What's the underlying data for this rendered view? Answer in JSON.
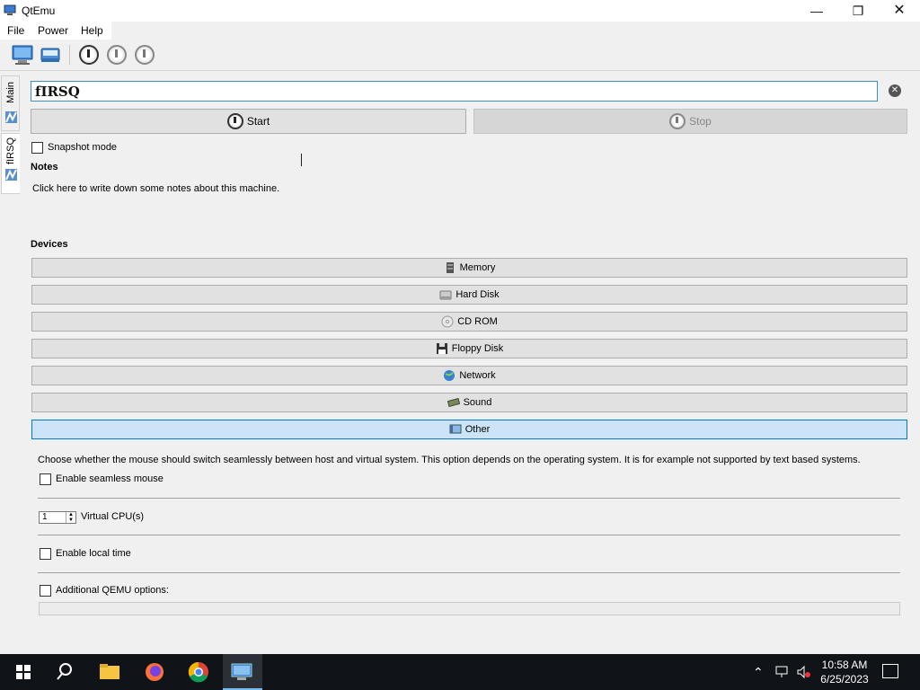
{
  "window": {
    "title": "QtEmu",
    "controls": {
      "minimize": "—",
      "maximize": "❐",
      "close": "✕"
    }
  },
  "menu": {
    "file": "File",
    "power": "Power",
    "help": "Help"
  },
  "toolbar": {
    "icons": [
      "new-machine-icon",
      "open-machine-icon",
      "start-icon",
      "stop-icon",
      "restart-icon"
    ]
  },
  "side_tabs": {
    "main": "Main",
    "machine": "fIRSQ"
  },
  "machine": {
    "name": "fIRSQ",
    "start_label": "Start",
    "stop_label": "Stop",
    "snapshot_label": "Snapshot mode",
    "snapshot_checked": false,
    "notes_heading": "Notes",
    "notes_placeholder": "Click here to write down some notes about this machine."
  },
  "devices": {
    "heading": "Devices",
    "items": [
      {
        "label": "Memory",
        "icon": "memory-icon"
      },
      {
        "label": "Hard Disk",
        "icon": "hard-disk-icon"
      },
      {
        "label": "CD ROM",
        "icon": "cdrom-icon"
      },
      {
        "label": "Floppy Disk",
        "icon": "floppy-icon"
      },
      {
        "label": "Network",
        "icon": "network-icon"
      },
      {
        "label": "Sound",
        "icon": "sound-icon"
      },
      {
        "label": "Other",
        "icon": "other-icon",
        "selected": true
      }
    ]
  },
  "other": {
    "description": "Choose whether the mouse should switch seamlessly between host and virtual system. This option depends on the operating system. It is for example not supported by text based systems.",
    "seamless_label": "Enable seamless mouse",
    "cpu_value": "1",
    "cpu_label": "Virtual CPU(s)",
    "localtime_label": "Enable local time",
    "qemu_options_label": "Additional QEMU options:",
    "qemu_options_value": ""
  },
  "taskbar": {
    "time": "10:58 AM",
    "date": "6/25/2023"
  },
  "colors": {
    "accent": "#0078d7",
    "selected_bg": "#cce4f7",
    "taskbar": "#101318"
  }
}
